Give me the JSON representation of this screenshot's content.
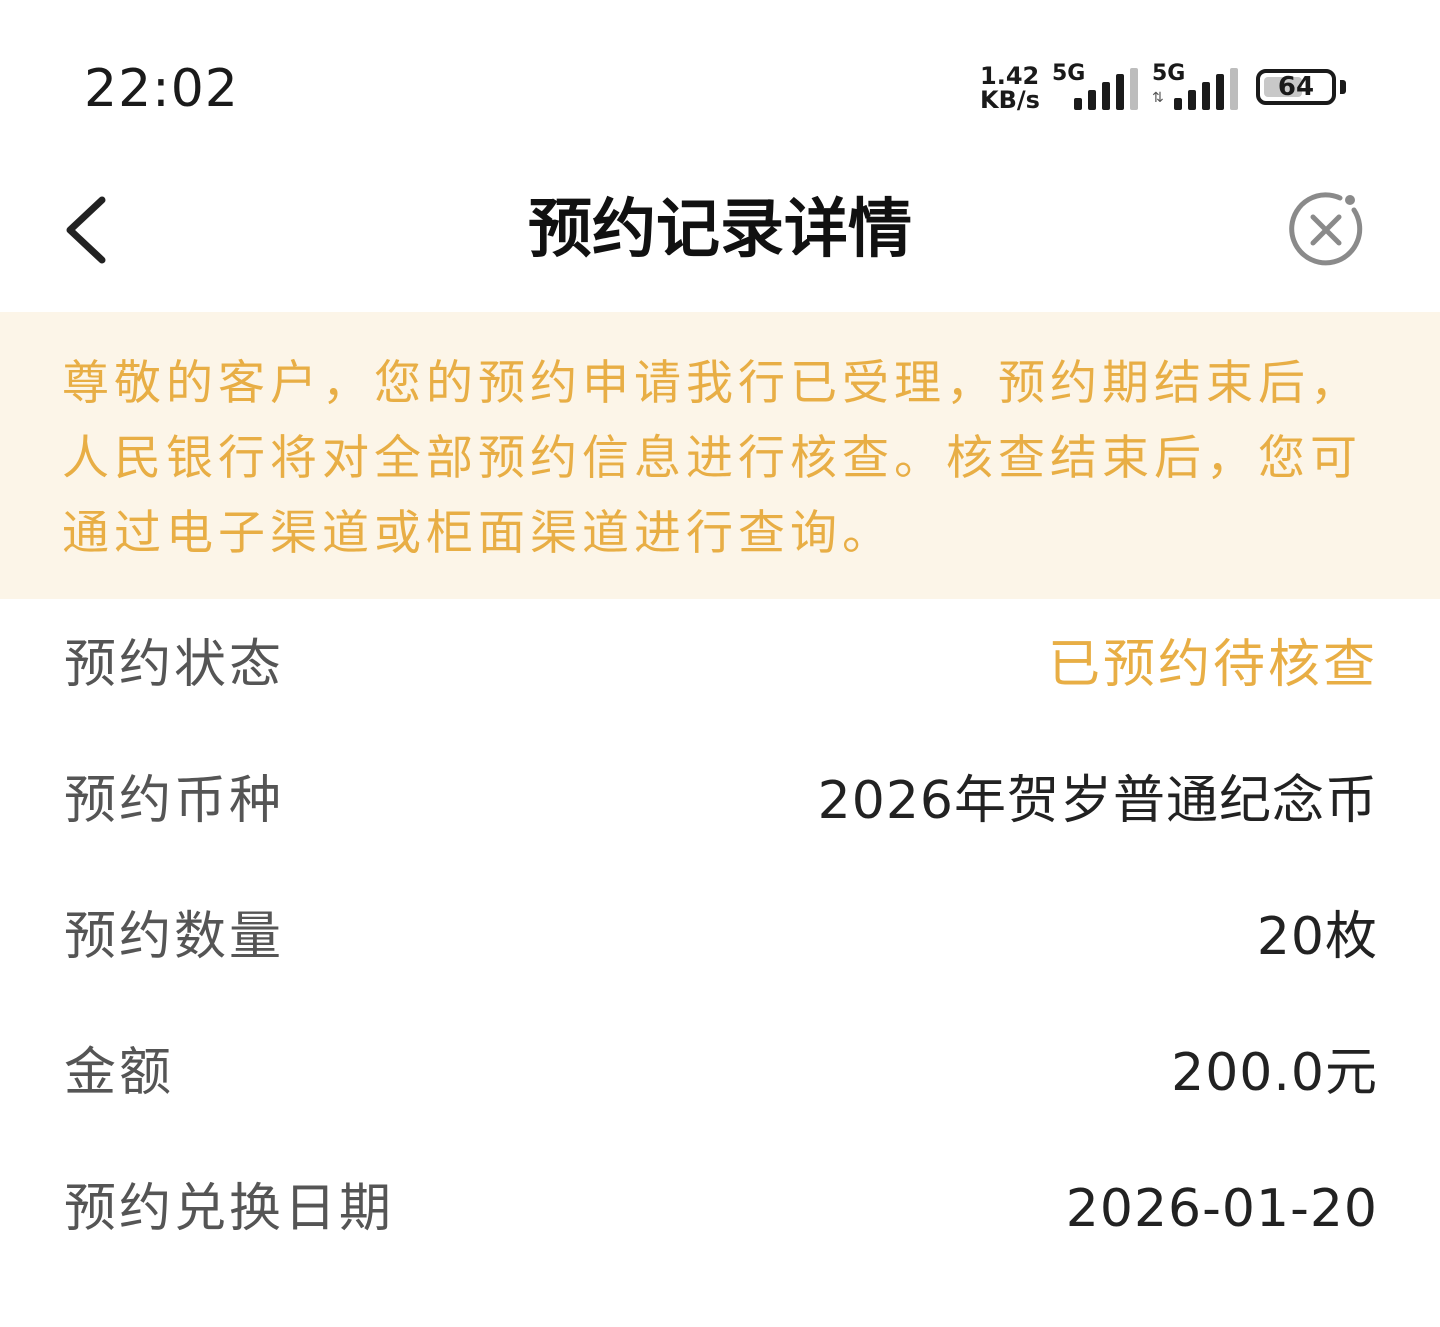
{
  "status_bar": {
    "time": "22:02",
    "net_speed_value": "1.42",
    "net_speed_unit": "KB/s",
    "sim1_label": "5G",
    "sim2_label": "5G",
    "battery": "64",
    "battery_level": 0.64
  },
  "nav": {
    "title": "预约记录详情"
  },
  "notice": {
    "text": "尊敬的客户，您的预约申请我行已受理，预约期结束后，人民银行将对全部预约信息进行核查。核查结束后，您可通过电子渠道或柜面渠道进行查询。",
    "color": "#e8ae45",
    "background": "#fcf5e8"
  },
  "details": [
    {
      "label": "预约状态",
      "value": "已预约待核查"
    },
    {
      "label": "预约币种",
      "value": "2026年贺岁普通纪念币"
    },
    {
      "label": "预约数量",
      "value": "20枚"
    },
    {
      "label": "金额",
      "value": "200.0元"
    },
    {
      "label": "预约兑换日期",
      "value": "2026-01-20"
    }
  ],
  "icons": {
    "back": "chevron-left-icon",
    "close": "close-circle-icon"
  }
}
